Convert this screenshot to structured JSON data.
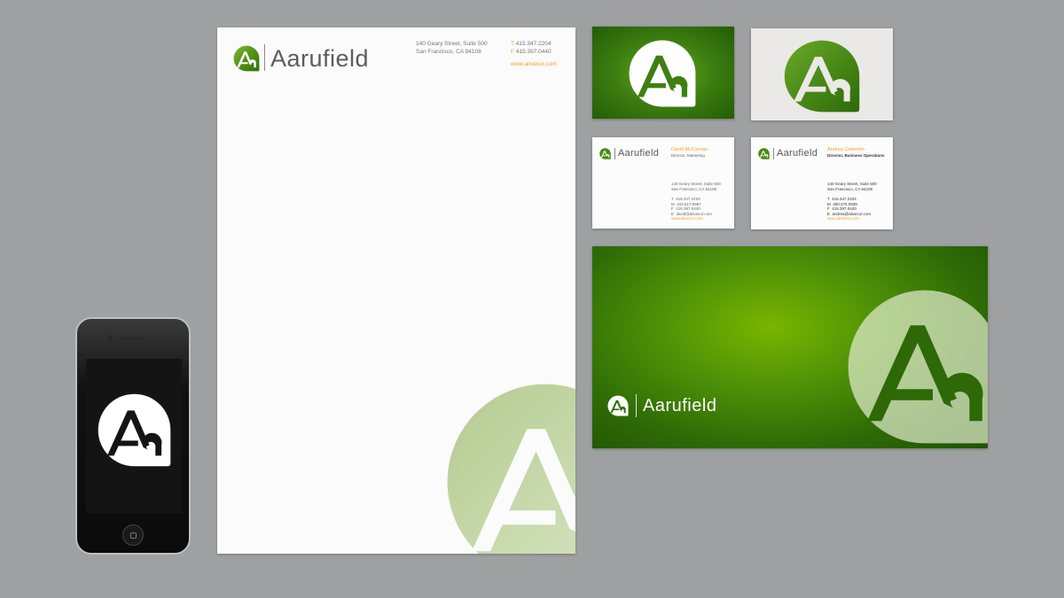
{
  "brand": {
    "name": "Aarufield",
    "monogram": "Aa",
    "colors": {
      "green_dark": "#245c06",
      "green_light": "#79b500",
      "accent_orange": "#f0a020",
      "text_grey": "#5d5d5d",
      "background": "#9fa0a2"
    },
    "icons": [
      "aa-monogram-icon"
    ]
  },
  "letterhead": {
    "address": "140 Geary Street, Suite 500\nSan Francisco, CA 94108",
    "phone_t_label": "T",
    "phone_t": "415.347.2204",
    "phone_f_label": "F",
    "phone_f": "415.397.0440",
    "url": "www.alivecor.com"
  },
  "card_david": {
    "name": "David McCarnan",
    "role": "Director, Marketing",
    "address": "140 Geary Street, Suite 500\nSan Francisco, CA 94108",
    "contacts": "T  415.347.2204\nM  415.517.9987\nF  415.397.0440\nE  david@alivecor.com",
    "url": "www.alivecor.com"
  },
  "card_andrea": {
    "name": "Andrea Caterrino",
    "role": "Director, Business Operations",
    "address": "140 Geary Street, Suite 500\nSan Francisco, CA 94108",
    "contacts": "T  415.347.2204\nM  460.476.0939\nF  415.397.0440\nE  andrea@alivecor.com",
    "url": "www.alivecor.com"
  },
  "banner": {
    "wordmark": "Aarufield"
  }
}
